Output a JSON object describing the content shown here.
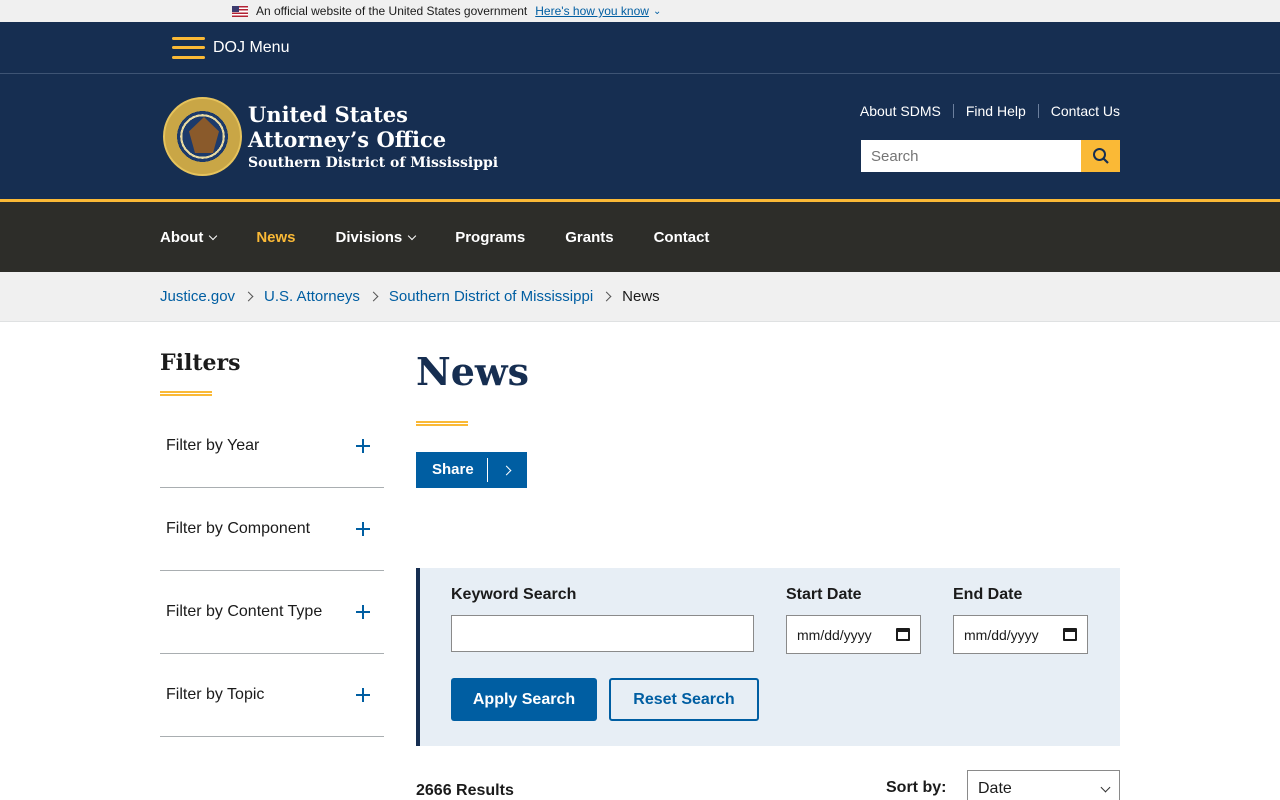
{
  "gov_banner": {
    "text": "An official website of the United States government",
    "link": "Here's how you know"
  },
  "doj_menu": {
    "label": "DOJ Menu"
  },
  "header": {
    "title_line1": "United States",
    "title_line2": "Attorney’s Office",
    "subtitle": "Southern District of Mississippi",
    "utility_links": [
      "About SDMS",
      "Find Help",
      "Contact Us"
    ],
    "search_placeholder": "Search"
  },
  "nav": {
    "items": [
      {
        "label": "About",
        "has_dropdown": true,
        "active": false
      },
      {
        "label": "News",
        "has_dropdown": false,
        "active": true
      },
      {
        "label": "Divisions",
        "has_dropdown": true,
        "active": false
      },
      {
        "label": "Programs",
        "has_dropdown": false,
        "active": false
      },
      {
        "label": "Grants",
        "has_dropdown": false,
        "active": false
      },
      {
        "label": "Contact",
        "has_dropdown": false,
        "active": false
      }
    ]
  },
  "breadcrumb": {
    "links": [
      "Justice.gov",
      "U.S. Attorneys",
      "Southern District of Mississippi"
    ],
    "current": "News"
  },
  "sidebar": {
    "title": "Filters",
    "filters": [
      "Filter by Year",
      "Filter by Component",
      "Filter by Content Type",
      "Filter by Topic"
    ]
  },
  "main": {
    "title": "News",
    "share_label": "Share"
  },
  "search_panel": {
    "keyword_label": "Keyword Search",
    "keyword_value": "",
    "start_label": "Start Date",
    "end_label": "End Date",
    "date_placeholder": "mm/dd/yyyy",
    "apply_label": "Apply Search",
    "reset_label": "Reset Search"
  },
  "results": {
    "count_text": "2666 Results",
    "sort_label": "Sort by:",
    "sort_value": "Date"
  },
  "colors": {
    "navy": "#162e51",
    "gold": "#fab936",
    "link_blue": "#005ea2",
    "nav_dark": "#2d2d29"
  }
}
